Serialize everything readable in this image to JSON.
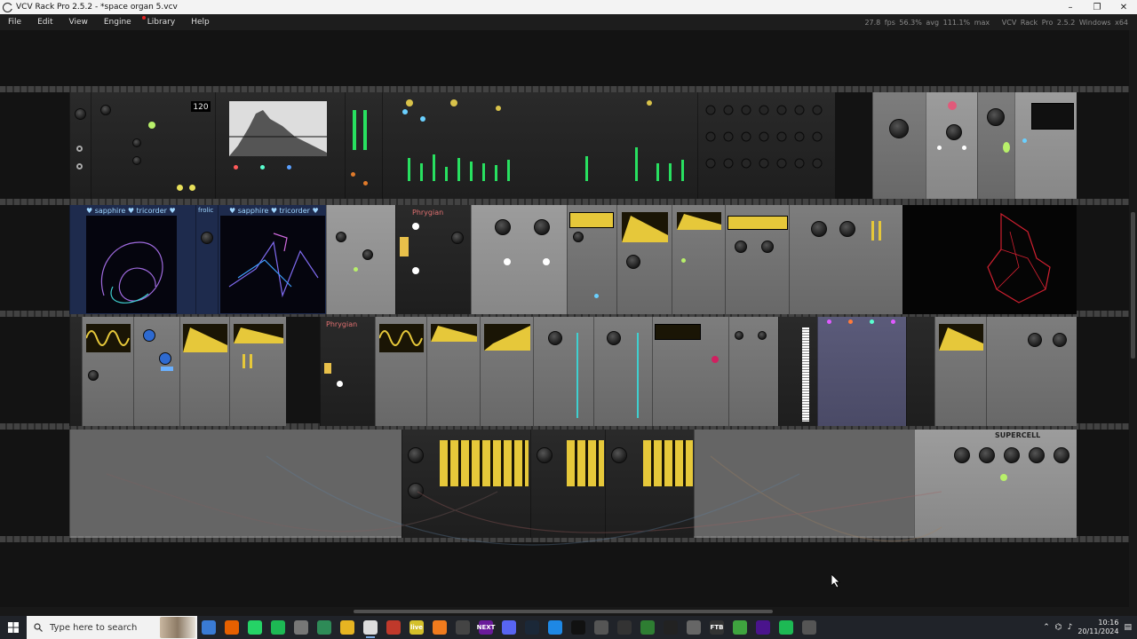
{
  "window": {
    "title": "VCV Rack Pro 2.5.2 - *space organ 5.vcv",
    "controls": [
      "–",
      "❐",
      "✕"
    ]
  },
  "menu": {
    "items": [
      "File",
      "Edit",
      "View",
      "Engine",
      "Library",
      "Help"
    ],
    "fps": "27.8 fps",
    "cpu_avg": "56.3% avg",
    "cpu_max": "111.1% max",
    "version": "VCV Rack Pro 2.5.2 Windows x64"
  },
  "modules": {
    "sapphire_1": "♥ sapphire ♥ tricorder ♥",
    "sapphire_2": "♥ sapphire ♥ tricorder ♥",
    "frolic": "frolic",
    "phrygian_1": "Phrygian",
    "phrygian_2": "Phrygian",
    "supercell": "SUPERCELL",
    "clock_display": "120"
  },
  "taskbar": {
    "search_placeholder": "Type here to search",
    "apps": [
      {
        "name": "copilot-icon",
        "label": "",
        "color": "#3a7bd5"
      },
      {
        "name": "firefox-icon",
        "label": "",
        "color": "#e66000"
      },
      {
        "name": "whatsapp-icon",
        "label": "",
        "color": "#25d366"
      },
      {
        "name": "spotify-icon",
        "label": "",
        "color": "#1db954"
      },
      {
        "name": "media-player-icon",
        "label": "",
        "color": "#777777"
      },
      {
        "name": "vpn-shield-icon",
        "label": "",
        "color": "#2e8b57"
      },
      {
        "name": "file-explorer-icon",
        "label": "",
        "color": "#e6b422"
      },
      {
        "name": "vcv-rack-icon",
        "label": "",
        "color": "#dddddd"
      },
      {
        "name": "reaper-icon",
        "label": "",
        "color": "#c0392b"
      },
      {
        "name": "live-icon",
        "label": "live",
        "color": "#d4c02a"
      },
      {
        "name": "audacity-icon",
        "label": "",
        "color": "#f07b1d"
      },
      {
        "name": "obs-icon",
        "label": "",
        "color": "#444444"
      },
      {
        "name": "next-icon",
        "label": "NEXT",
        "color": "#6a1b9a"
      },
      {
        "name": "discord-icon",
        "label": "",
        "color": "#5865f2"
      },
      {
        "name": "steam-icon",
        "label": "",
        "color": "#1b2838"
      },
      {
        "name": "browser-icon",
        "label": "",
        "color": "#1e88e5"
      },
      {
        "name": "capcut-icon",
        "label": "",
        "color": "#111111"
      },
      {
        "name": "synth-icon",
        "label": "",
        "color": "#555555"
      },
      {
        "name": "davinci-icon",
        "label": "",
        "color": "#333333"
      },
      {
        "name": "plugin-icon",
        "label": "",
        "color": "#2e7d32"
      },
      {
        "name": "notepad-icon",
        "label": "",
        "color": "#222222"
      },
      {
        "name": "word-icon",
        "label": "",
        "color": "#666666"
      },
      {
        "name": "ftb-icon",
        "label": "FTB",
        "color": "#333333"
      },
      {
        "name": "minecraft-icon",
        "label": "",
        "color": "#3fa43f"
      },
      {
        "name": "hexo-icon",
        "label": "",
        "color": "#4a148c"
      },
      {
        "name": "spotify2-icon",
        "label": "",
        "color": "#1db954"
      },
      {
        "name": "rec-icon",
        "label": "",
        "color": "#555555"
      }
    ],
    "time": "10:16",
    "date": "20/11/2024"
  }
}
